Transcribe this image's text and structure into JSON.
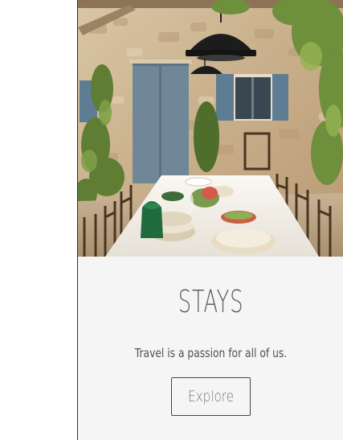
{
  "card": {
    "image": {
      "semantic": "outdoor dining table under a pergola in front of a stone farmhouse",
      "colors": {
        "wall": "#cdb89a",
        "door": "#6f8796",
        "shutter": "#5e7d93",
        "tablecloth": "#f1ede6",
        "foliage": "#6e8f3c",
        "lamp": "#1c1c1c"
      }
    },
    "title": "STAYS",
    "tagline": "Travel is a passion for all of us.",
    "explore_label": "Explore"
  },
  "colors": {
    "card_background": "#f5f5f5",
    "title_text": "#606060",
    "body_text": "#505050",
    "button_border": "#444444"
  }
}
